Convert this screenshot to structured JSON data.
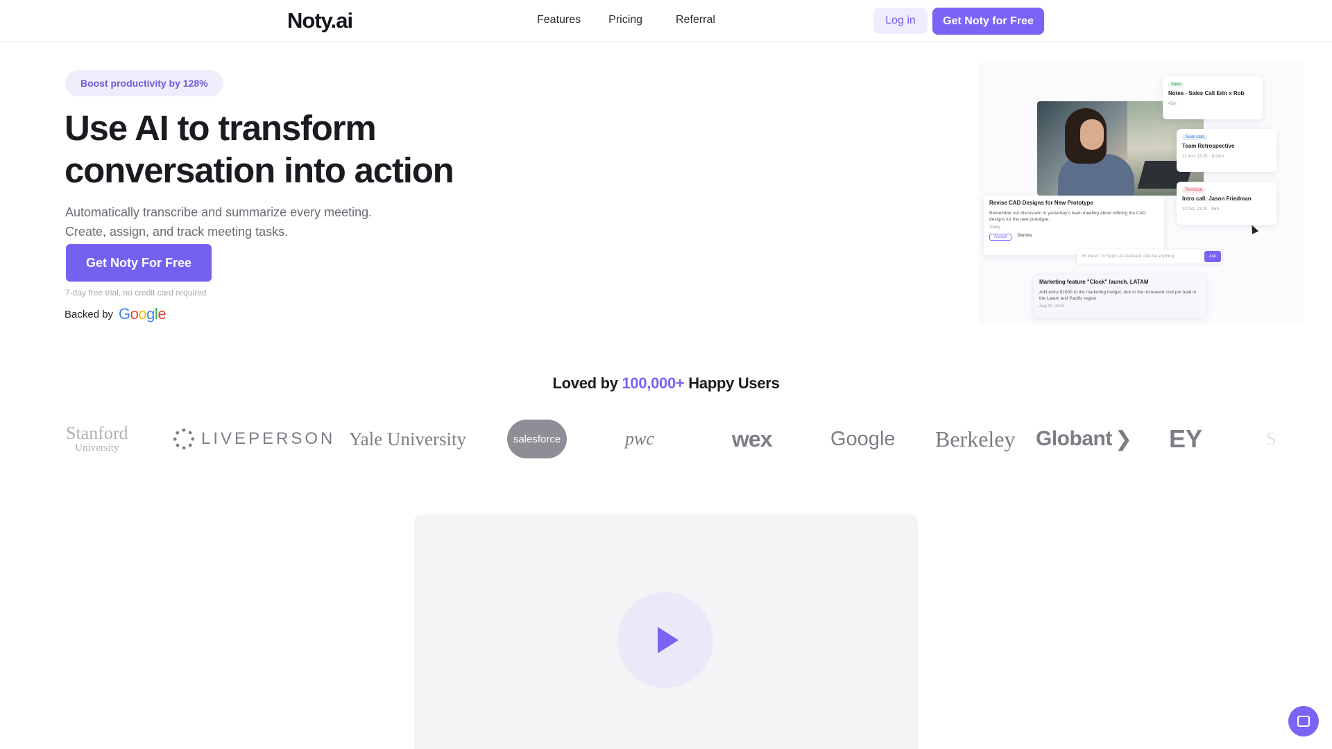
{
  "nav": {
    "logo": "Noty.ai",
    "links": [
      "Features",
      "Pricing",
      "Referral"
    ],
    "login_label": "Log in",
    "cta_label": "Get Noty for Free"
  },
  "hero": {
    "badge": "Boost productivity by 128%",
    "title_line1": "Use AI to transform",
    "title_line2": "conversation into action",
    "subtitle_line1": "Automatically transcribe and summarize every meeting.",
    "subtitle_line2": "Create, assign, and track meeting tasks.",
    "cta_label": "Get Noty For Free",
    "trial_note": "7-day free trial, no credit card required",
    "backed_by": "Backed by",
    "backer": "Google"
  },
  "illustration": {
    "notes_card": {
      "tag": "Sales",
      "title": "Notes - Sales Call Erin x Rob",
      "meta": "45m"
    },
    "team_card": {
      "tag": "Team calls",
      "title": "Team Retrospective",
      "meta": "22 Jun, 13:25 · 1h10m"
    },
    "intro_card": {
      "tag": "Technical",
      "title": "Intro call: Jason Friedman",
      "meta": "13 Oct, 13:20 · 35m"
    },
    "cad_card": {
      "title": "Revise CAD Designs for New Prototype",
      "body": "Remember our discussion in yesterday's team meeting about refining the CAD designs for the new prototype.",
      "due": "Today",
      "accept": "Accept",
      "dismiss": "Dismiss"
    },
    "ask_placeholder": "Hi there! I`m Noty`s AI Assistant. Ask me anything",
    "ask_button": "Ask",
    "mkt_card": {
      "title": "Marketing feature \"Clock\" launch. LATAM",
      "body": "Add extra $1000 to the marketing budget, due to the increased cost per lead in the Latam and Pacific region",
      "due": "Aug 30, 2024"
    }
  },
  "social": {
    "loved_prefix": "Loved by ",
    "loved_count": "100,000+",
    "loved_suffix": " Happy Users",
    "logos": {
      "stanford": "Stanford",
      "stanford_sub": "University",
      "liveperson": "LIVEPERSON",
      "yale": "Yale University",
      "salesforce": "salesforce",
      "pwc": "pwc",
      "wex": "wex",
      "google": "Google",
      "berkeley": "Berkeley",
      "globant": "Globant",
      "ey": "EY"
    }
  },
  "colors": {
    "accent": "#7b63f6",
    "accent_light": "#efedfd",
    "text": "#1a1a20",
    "muted": "#6b6b74"
  },
  "icons": {
    "play": "play-icon",
    "chat": "chat-icon"
  }
}
